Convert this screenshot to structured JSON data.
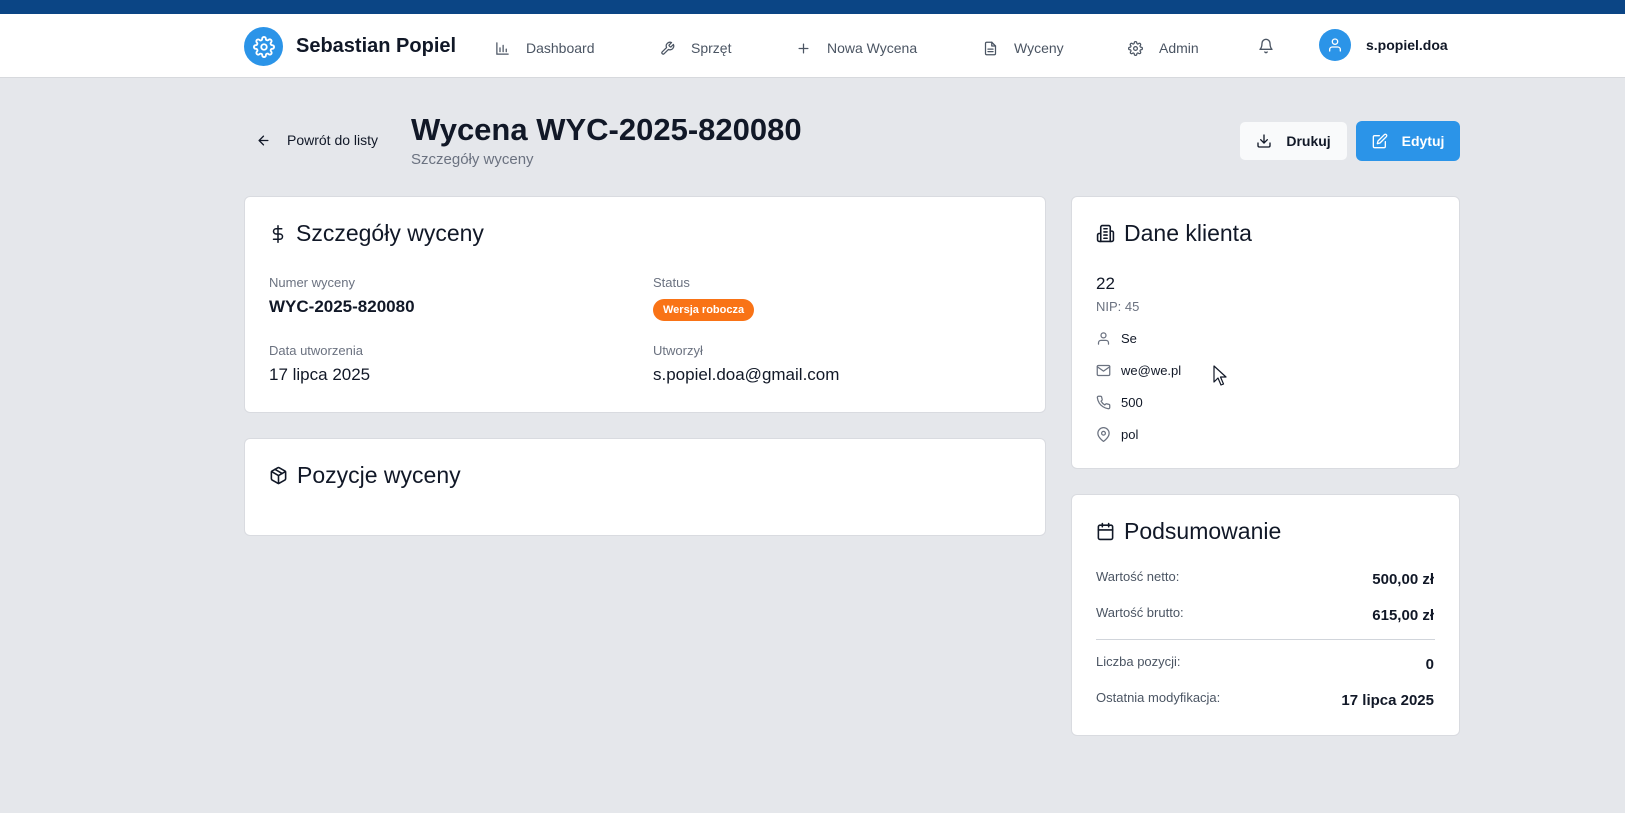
{
  "app": {
    "brand_name": "Sebastian Popiel",
    "nav": [
      "Dashboard",
      "Sprzęt",
      "Nowa Wycena",
      "Wyceny",
      "Admin"
    ],
    "user_name": "s.popiel.doa"
  },
  "header": {
    "back_label": "Powrót do listy",
    "title": "Wycena WYC-2025-820080",
    "subtitle": "Szczegóły wyceny",
    "print_label": "Drukuj",
    "edit_label": "Edytuj"
  },
  "details": {
    "title": "Szczegóły wyceny",
    "number_label": "Numer wyceny",
    "number_value": "WYC-2025-820080",
    "status_label": "Status",
    "status_value": "Wersja robocza",
    "date_label": "Data utworzenia",
    "date_value": "17 lipca 2025",
    "author_label": "Utworzył",
    "author_value": "s.popiel.doa@gmail.com"
  },
  "items": {
    "title": "Pozycje wyceny"
  },
  "client": {
    "title": "Dane klienta",
    "name": "22",
    "nip": "NIP: 45",
    "contact": "Se",
    "email": "we@we.pl",
    "phone": "500",
    "address": "pol"
  },
  "summary": {
    "title": "Podsumowanie",
    "net_label": "Wartość netto:",
    "net_value": "500,00 zł",
    "gross_label": "Wartość brutto:",
    "gross_value": "615,00 zł",
    "count_label": "Liczba pozycji:",
    "count_value": "0",
    "modified_label": "Ostatnia modyfikacja:",
    "modified_value": "17 lipca 2025"
  },
  "colors": {
    "primary": "#2b94e8",
    "topbar": "#0b4585",
    "badge": "#f97316",
    "background": "#e5e7eb"
  }
}
